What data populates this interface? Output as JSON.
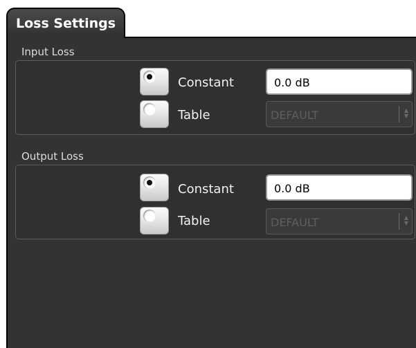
{
  "dialog": {
    "tab_title": "Loss Settings"
  },
  "input_loss": {
    "title": "Input Loss",
    "constant_label": "Constant",
    "constant_value": "0.0 dB",
    "constant_selected": true,
    "table_label": "Table",
    "table_value": "DEFAULT",
    "table_selected": false
  },
  "output_loss": {
    "title": "Output Loss",
    "constant_label": "Constant",
    "constant_value": "0.0 dB",
    "constant_selected": true,
    "table_label": "Table",
    "table_value": "DEFAULT",
    "table_selected": false
  }
}
